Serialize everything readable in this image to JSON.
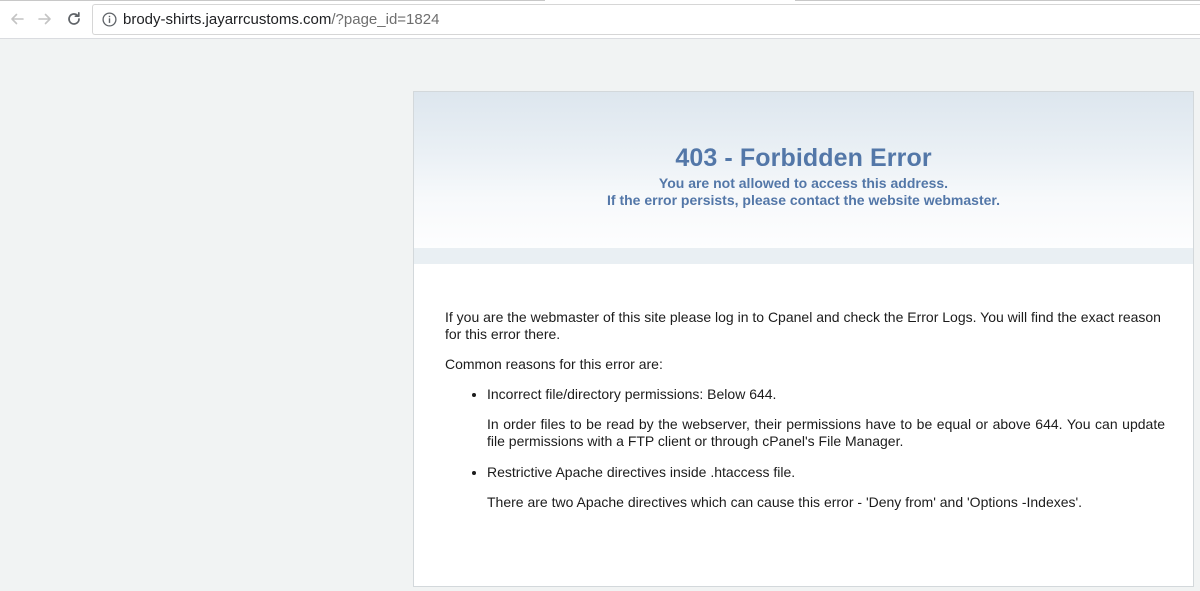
{
  "browser": {
    "back_icon": "back-arrow-icon",
    "forward_icon": "forward-arrow-icon",
    "reload_icon": "reload-icon",
    "info_icon": "info-icon",
    "url_host": "brody-shirts.jayarrcustoms.com",
    "url_rest": "/?page_id=1824"
  },
  "error": {
    "title": "403 - Forbidden Error",
    "subtitle_line1": "You are not allowed to access this address.",
    "subtitle_line2": "If the error persists, please contact the website webmaster.",
    "intro": "If you are the webmaster of this site please log in to Cpanel and check the Error Logs. You will find the exact reason for this error there.",
    "common_heading": "Common reasons for this error are:",
    "reasons": [
      {
        "title": "Incorrect file/directory permissions: Below 644.",
        "detail": "In order files to be read by the webserver, their permissions have to be equal or above 644. You can update file permissions with a FTP client or through cPanel's File Manager."
      },
      {
        "title": "Restrictive Apache directives inside .htaccess file.",
        "detail": "There are two Apache directives which can cause this error - 'Deny from' and 'Options -Indexes'."
      }
    ]
  },
  "colors": {
    "accent": "#5377a8",
    "page_bg": "#f1f3f3",
    "panel_border": "#d3d8db"
  }
}
